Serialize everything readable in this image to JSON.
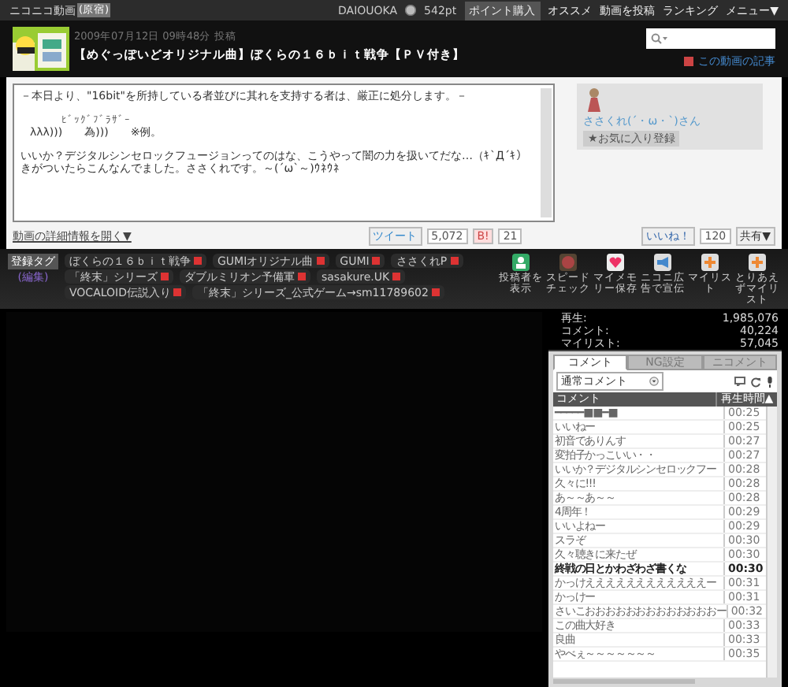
{
  "topbar": {
    "logo": "ニコニコ動画",
    "logo_badge": "(原宿)",
    "user": "DAIOUOKA",
    "points": "542pt",
    "buy_button": "ポイント購入",
    "menu": [
      "オススメ",
      "動画を投稿",
      "ランキング",
      "メニュー▼"
    ]
  },
  "video": {
    "posted": "2009年07月12日 09時48分 投稿",
    "title": "【めぐっぽいどオリジナル曲】ぼくらの１６ｂｉｔ戦争【ＰＶ付き】",
    "article_link": "この動画の記事"
  },
  "description": {
    "lines": [
      "－本日より、\"16bit\"を所持している者並びに其れを支持する者は、厳正に処分します。－",
      "ﾋﾞｯｸﾞﾌﾞﾗｻﾞｰ",
      "λλλ)))　　為)))　　※例。",
      "いいか？デジタルシンセロックフュージョンってのはな、こうやって闇の力を扱いてだな…（ｷ`Д´ｷ）",
      "きがついたらこんなんでました。ささくれです。～(´ω`～)ｳﾈｳﾈ"
    ],
    "details_link": "動画の詳細情報を開く▼"
  },
  "owner": {
    "name": "ささくれ(´・ω・`)さん",
    "favorite_button": "★お気に入り登録"
  },
  "share": {
    "tweet": "ツイート",
    "tweet_count": "5,072",
    "hatena": "B!",
    "hatena_count": "21",
    "like": "いいね！",
    "like_count": "120",
    "share_button": "共有▼"
  },
  "tags": {
    "label": "登録タグ",
    "edit": "(編集)",
    "items": [
      "ぼくらの１６ｂｉｔ戦争",
      "GUMIオリジナル曲",
      "GUMI",
      "ささくれP",
      "「終末」シリーズ",
      "ダブルミリオン予備軍",
      "sasakure.UK",
      "VOCALOID伝説入り",
      "「終末」シリーズ_公式ゲーム→sm11789602"
    ]
  },
  "tools": [
    {
      "kind": "owner",
      "label": "投稿者を表示"
    },
    {
      "kind": "speed",
      "label": "スピードチェック"
    },
    {
      "kind": "memory",
      "label": "マイメモリー保存"
    },
    {
      "kind": "ad",
      "label": "ニコニ広告で宣伝"
    },
    {
      "kind": "mylist",
      "label": "マイリスト"
    },
    {
      "kind": "quick",
      "label": "とりあえずマイリスト"
    }
  ],
  "stats": [
    {
      "label": "再生:",
      "value": "1,985,076"
    },
    {
      "label": "コメント:",
      "value": "40,224"
    },
    {
      "label": "マイリスト:",
      "value": "57,045"
    }
  ],
  "panel_tabs": [
    {
      "label": "コメント",
      "selected": true
    },
    {
      "label": "NG設定",
      "selected": false
    },
    {
      "label": "ニコメント",
      "selected": false
    }
  ],
  "comment_filter": "通常コメント",
  "comment_columns": [
    "コメント",
    "再生時間▲"
  ],
  "comments": [
    {
      "text": "━━━━━■■━■",
      "time": "00:25",
      "bold": false
    },
    {
      "text": "いいねー",
      "time": "00:25",
      "bold": false
    },
    {
      "text": "初音でありんす",
      "time": "00:27",
      "bold": false
    },
    {
      "text": "変拍子かっこいい・・",
      "time": "00:27",
      "bold": false
    },
    {
      "text": "いいか？デジタルシンセロックフー",
      "time": "00:28",
      "bold": false
    },
    {
      "text": "久々に!!!",
      "time": "00:28",
      "bold": false
    },
    {
      "text": "あ～～あ～～",
      "time": "00:28",
      "bold": false
    },
    {
      "text": "4周年！",
      "time": "00:29",
      "bold": false
    },
    {
      "text": "いいよねー",
      "time": "00:29",
      "bold": false
    },
    {
      "text": "スラぞ",
      "time": "00:30",
      "bold": false
    },
    {
      "text": "久々聴きに来たぜ",
      "time": "00:30",
      "bold": false
    },
    {
      "text": "終戦の日とかわざわざ書くな",
      "time": "00:30",
      "bold": true
    },
    {
      "text": "かっけええええええええええええー",
      "time": "00:31",
      "bold": false
    },
    {
      "text": "かっけー",
      "time": "00:31",
      "bold": false
    },
    {
      "text": "さいこおおおおおおおおおおおおおー",
      "time": "00:32",
      "bold": false
    },
    {
      "text": "この曲大好き",
      "time": "00:33",
      "bold": false
    },
    {
      "text": "良曲",
      "time": "00:33",
      "bold": false
    },
    {
      "text": "やべぇ～～～～～～～",
      "time": "00:35",
      "bold": false
    }
  ]
}
